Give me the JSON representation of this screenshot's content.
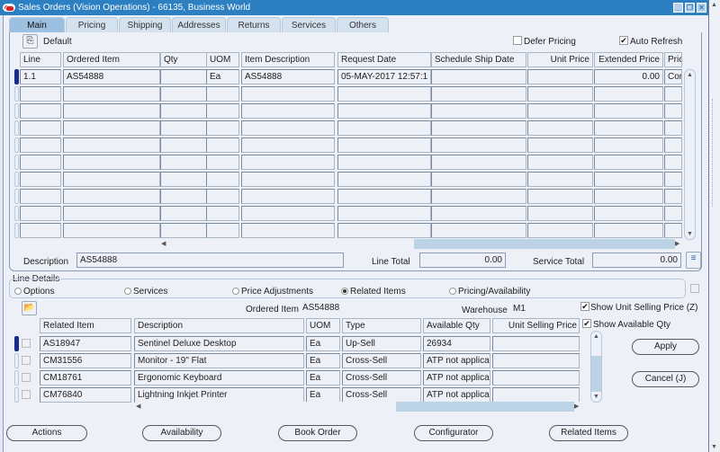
{
  "window": {
    "title": "Sales Orders (Vision Operations) - 66135, Business World",
    "controls": [
      "minimize",
      "restore",
      "close"
    ]
  },
  "tabs": [
    {
      "label": "Main",
      "active": true
    },
    {
      "label": "Pricing",
      "active": false
    },
    {
      "label": "Shipping",
      "active": false
    },
    {
      "label": "Addresses",
      "active": false
    },
    {
      "label": "Returns",
      "active": false
    },
    {
      "label": "Services",
      "active": false
    },
    {
      "label": "Others",
      "active": false
    }
  ],
  "main": {
    "default_label": "Default",
    "defer_pricing": {
      "label": "Defer Pricing",
      "checked": false
    },
    "auto_refresh": {
      "label": "Auto Refresh",
      "checked": true
    },
    "lines_table": {
      "columns": [
        "Line",
        "Ordered Item",
        "Qty",
        "UOM",
        "Item Description",
        "Request Date",
        "Schedule Ship Date",
        "Unit Price",
        "Extended Price",
        "Pric"
      ],
      "rows": [
        [
          "1.1",
          "AS54888",
          "",
          "Ea",
          "AS54888",
          "05-MAY-2017 12:57:1",
          "",
          "",
          "0.00",
          "Cor"
        ]
      ],
      "empty_rows": 9
    },
    "description_label": "Description",
    "description_value": "AS54888",
    "line_total_label": "Line Total",
    "line_total_value": "0.00",
    "service_total_label": "Service Total",
    "service_total_value": "0.00"
  },
  "line_details": {
    "label": "Line Details",
    "options": [
      {
        "label": "Options",
        "selected": false
      },
      {
        "label": "Services",
        "selected": false
      },
      {
        "label": "Price Adjustments",
        "selected": false
      },
      {
        "label": "Related Items",
        "selected": true
      },
      {
        "label": "Pricing/Availability",
        "selected": false
      }
    ],
    "ordered_item_label": "Ordered Item",
    "ordered_item_value": "AS54888",
    "warehouse_label": "Warehouse",
    "warehouse_value": "M1",
    "show_unit_selling_price": {
      "label": "Show Unit Selling Price (Z)",
      "checked": true
    },
    "show_available_qty": {
      "label": "Show Available Qty",
      "checked": true
    },
    "related_table": {
      "columns": [
        "Related Item",
        "Description",
        "UOM",
        "Type",
        "Available Qty",
        "Unit Selling Price"
      ],
      "rows": [
        [
          "AS18947",
          "Sentinel Deluxe Desktop",
          "Ea",
          "Up-Sell",
          "26934",
          ""
        ],
        [
          "CM31556",
          "Monitor - 19\" Flat",
          "Ea",
          "Cross-Sell",
          "ATP not applica",
          ""
        ],
        [
          "CM18761",
          "Ergonomic Keyboard",
          "Ea",
          "Cross-Sell",
          "ATP not applica",
          ""
        ],
        [
          "CM76840",
          "Lightning Inkjet Printer",
          "Ea",
          "Cross-Sell",
          "ATP not applica",
          ""
        ]
      ]
    },
    "apply_label": "Apply",
    "cancel_label": "Cancel (J)"
  },
  "footer_buttons": [
    "Actions",
    "Availability",
    "Book Order",
    "Configurator",
    "Related Items"
  ]
}
